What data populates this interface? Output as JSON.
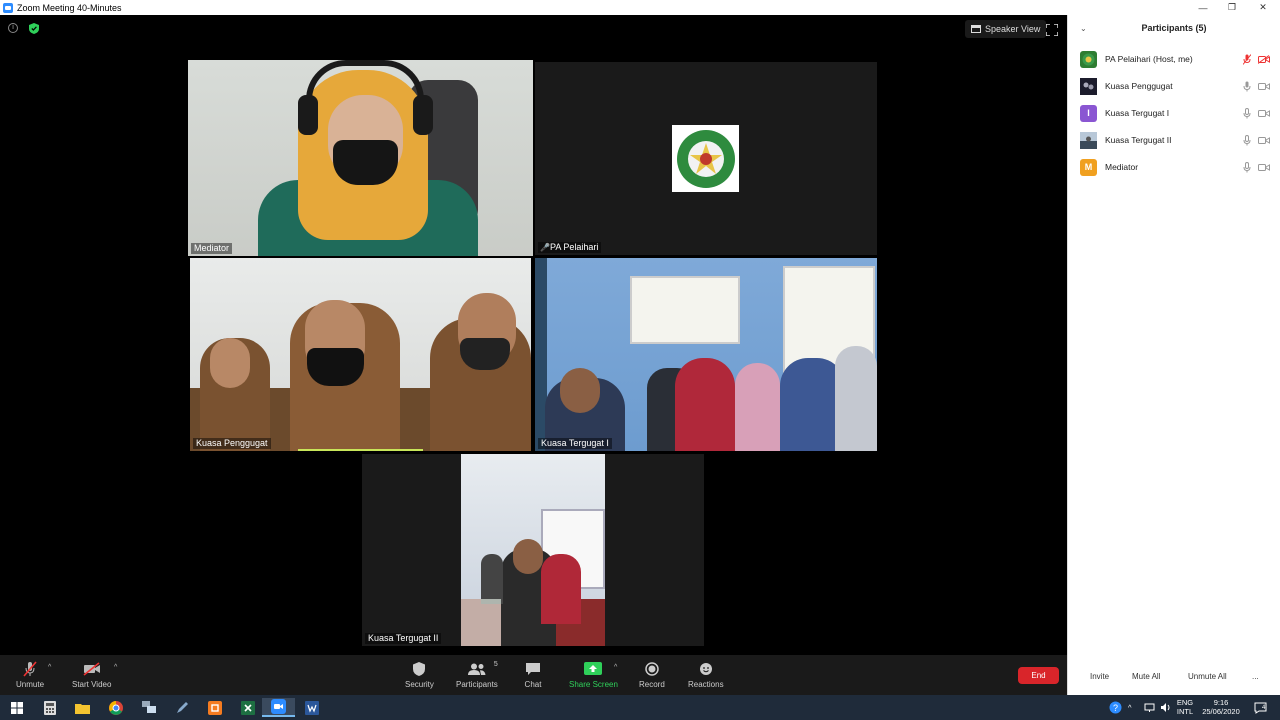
{
  "window": {
    "title": "Zoom Meeting 40-Minutes",
    "minimize": "—",
    "maximize": "❐",
    "close": "✕"
  },
  "meeting": {
    "view_button": "Speaker View",
    "tiles": [
      {
        "name": "Mediator",
        "active": true
      },
      {
        "name": "PA Pelaihari",
        "muted": true
      },
      {
        "name": "Kuasa Penggugat"
      },
      {
        "name": "Kuasa Tergugat I"
      },
      {
        "name": "Kuasa Tergugat II"
      }
    ]
  },
  "controls": {
    "unmute": "Unmute",
    "start_video": "Start Video",
    "security": "Security",
    "participants": "Participants",
    "participants_count": "5",
    "chat": "Chat",
    "share_screen": "Share Screen",
    "record": "Record",
    "reactions": "Reactions",
    "end": "End"
  },
  "panel": {
    "title": "Participants (5)",
    "participants": [
      {
        "name": "PA Pelaihari (Host, me)",
        "avatar": "logo-avatar",
        "avatar_color": "#2e7d32",
        "mic": "muted",
        "video": "off"
      },
      {
        "name": "Kuasa Penggugat",
        "avatar": "photo-avatar",
        "avatar_color": "#2b2b3a",
        "mic": "on",
        "video": "on"
      },
      {
        "name": "Kuasa Tergugat I",
        "avatar_letter": "I",
        "avatar_color": "#8a56d2",
        "mic": "on",
        "video": "on"
      },
      {
        "name": "Kuasa Tergugat II",
        "avatar": "photo-avatar",
        "avatar_color": "#4a5a6a",
        "mic": "on",
        "video": "on"
      },
      {
        "name": "Mediator",
        "avatar_letter": "M",
        "avatar_color": "#f0a020",
        "mic": "on",
        "video": "on"
      }
    ],
    "invite": "Invite",
    "mute_all": "Mute All",
    "unmute_all": "Unmute All",
    "more": "..."
  },
  "taskbar": {
    "lang": "ENG",
    "layout": "INTL",
    "time": "9:16",
    "date": "25/06/2020",
    "notification_count": "4",
    "colors": {
      "background": "#1f2b3a",
      "active": "#3a4a5e"
    }
  }
}
